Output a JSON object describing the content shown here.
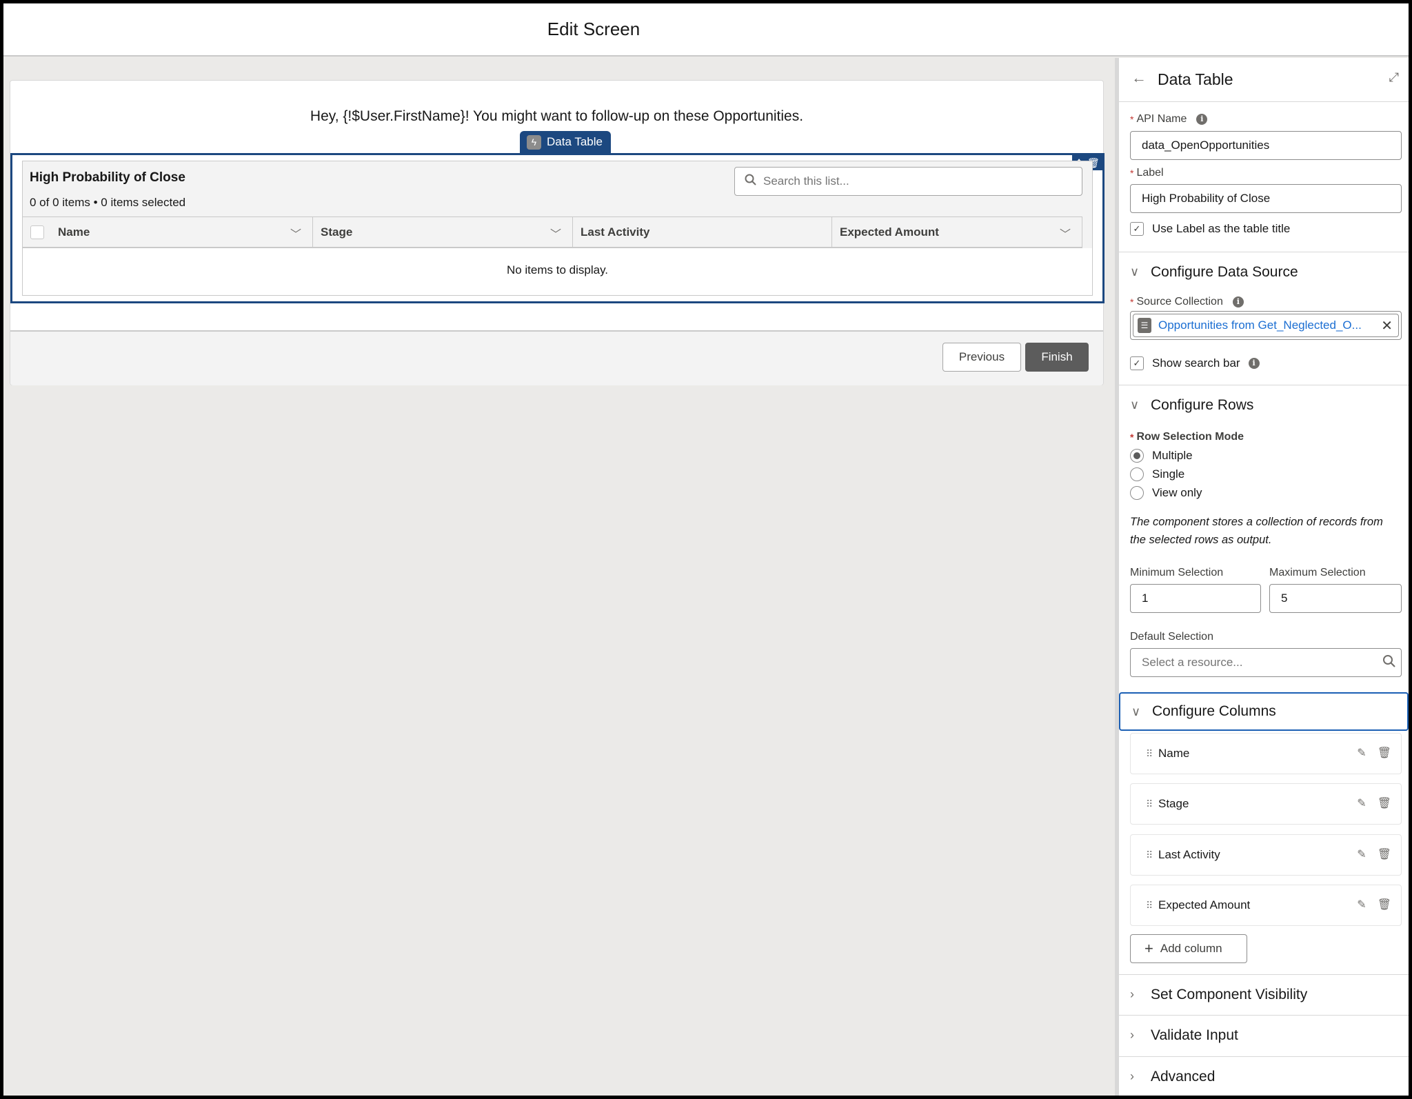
{
  "header": {
    "title": "Edit Screen"
  },
  "canvas": {
    "greeting": "Hey, {!$User.FirstName}! You might want to follow-up on these Opportunities.",
    "component_badge": "Data Table",
    "data_table": {
      "title": "High Probability of Close",
      "count_text": "0 of 0 items • 0 items selected",
      "search_placeholder": "Search this list...",
      "columns": [
        {
          "label": "Name",
          "has_menu": true
        },
        {
          "label": "Stage",
          "has_menu": true
        },
        {
          "label": "Last Activity",
          "has_menu": false
        },
        {
          "label": "Expected Amount",
          "has_menu": true
        }
      ],
      "empty_text": "No items to display."
    },
    "footer": {
      "previous_label": "Previous",
      "finish_label": "Finish"
    }
  },
  "panel": {
    "title": "Data Table",
    "api_name": {
      "label": "API Name",
      "value": "data_OpenOpportunities"
    },
    "label_field": {
      "label": "Label",
      "value": "High Probability of Close"
    },
    "use_label_checkbox": {
      "label": "Use Label as the table title",
      "checked": true
    },
    "sections": {
      "data_source": "Configure Data Source",
      "rows": "Configure Rows",
      "columns": "Configure Columns",
      "visibility": "Set Component Visibility",
      "validate": "Validate Input",
      "advanced": "Advanced"
    },
    "source_collection": {
      "label": "Source Collection",
      "value": "Opportunities from Get_Neglected_O..."
    },
    "show_search_bar": {
      "label": "Show search bar",
      "checked": true
    },
    "row_selection": {
      "label": "Row Selection Mode",
      "options": [
        "Multiple",
        "Single",
        "View only"
      ],
      "selected": "Multiple"
    },
    "help_text": "The component stores a collection of records from the selected rows as output.",
    "min_selection": {
      "label": "Minimum Selection",
      "value": "1"
    },
    "max_selection": {
      "label": "Maximum Selection",
      "value": "5"
    },
    "default_selection": {
      "label": "Default Selection",
      "placeholder": "Select a resource..."
    },
    "columns": [
      "Name",
      "Stage",
      "Last Activity",
      "Expected Amount"
    ],
    "add_column_label": "Add column"
  },
  "colors": {
    "brand_blue": "#1c4880",
    "focus_blue": "#1b5fb4",
    "link_blue": "#1b6ed2",
    "required_red": "#c23934",
    "finish_gray": "#5c5c5c"
  }
}
